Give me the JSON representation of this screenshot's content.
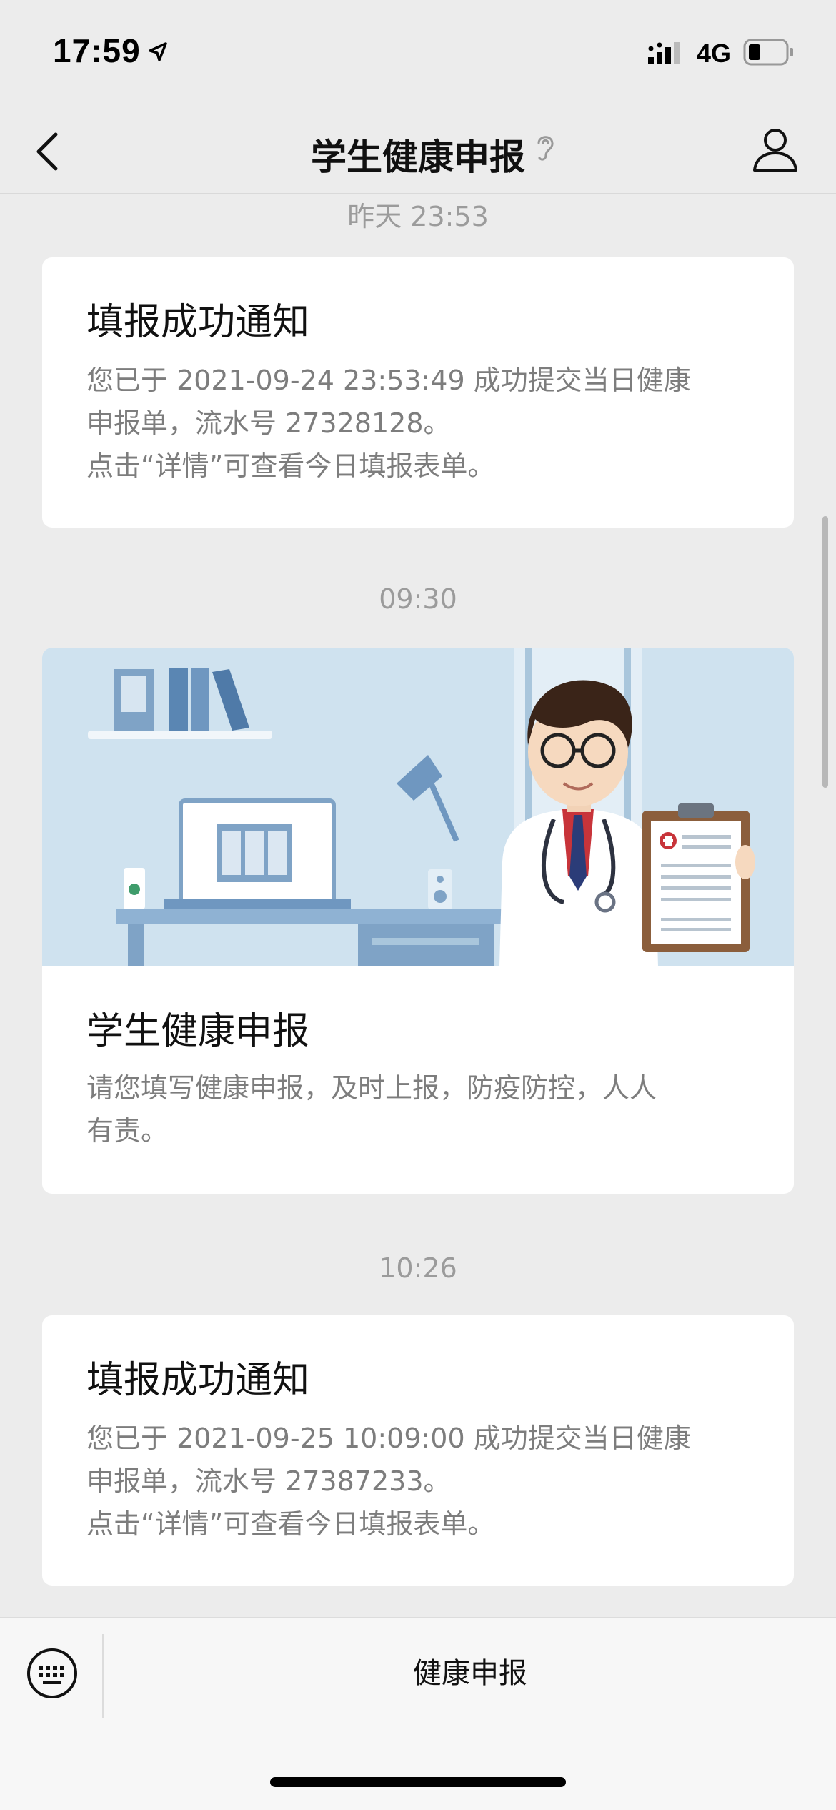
{
  "status_bar": {
    "time": "17:59",
    "network": "4G",
    "icons": [
      "location-arrow-icon",
      "signal-icon",
      "battery-icon"
    ]
  },
  "nav": {
    "title": "学生健康申报",
    "icons": [
      "back-chevron-icon",
      "ear-icon",
      "profile-icon"
    ]
  },
  "messages": [
    {
      "timestamp": "昨天 23:53",
      "title": "填报成功通知",
      "lines": [
        "您已于 2021-09-24 23:53:49 成功提交当日健康",
        "申报单，流水号 27328128。",
        "点击“详情”可查看今日填报表单。"
      ]
    },
    {
      "timestamp": "09:30",
      "title": "学生健康申报",
      "lines": [
        "请您填写健康申报，及时上报，防疫防控，人人",
        "有责。"
      ],
      "image": "doctor-illustration"
    },
    {
      "timestamp": "10:26",
      "title": "填报成功通知",
      "lines": [
        "您已于 2021-09-25 10:09:00 成功提交当日健康",
        "申报单，流水号 27387233。",
        "点击“详情”可查看今日填报表单。"
      ]
    }
  ],
  "bottom_bar": {
    "menu_label": "健康申报",
    "icons": [
      "keyboard-icon"
    ]
  },
  "colors": {
    "background": "#ececec",
    "card": "#ffffff",
    "secondary_text": "#7d7d7d",
    "timestamp_text": "#9b9b9b",
    "illustration_bg": "#cfe2ef"
  }
}
